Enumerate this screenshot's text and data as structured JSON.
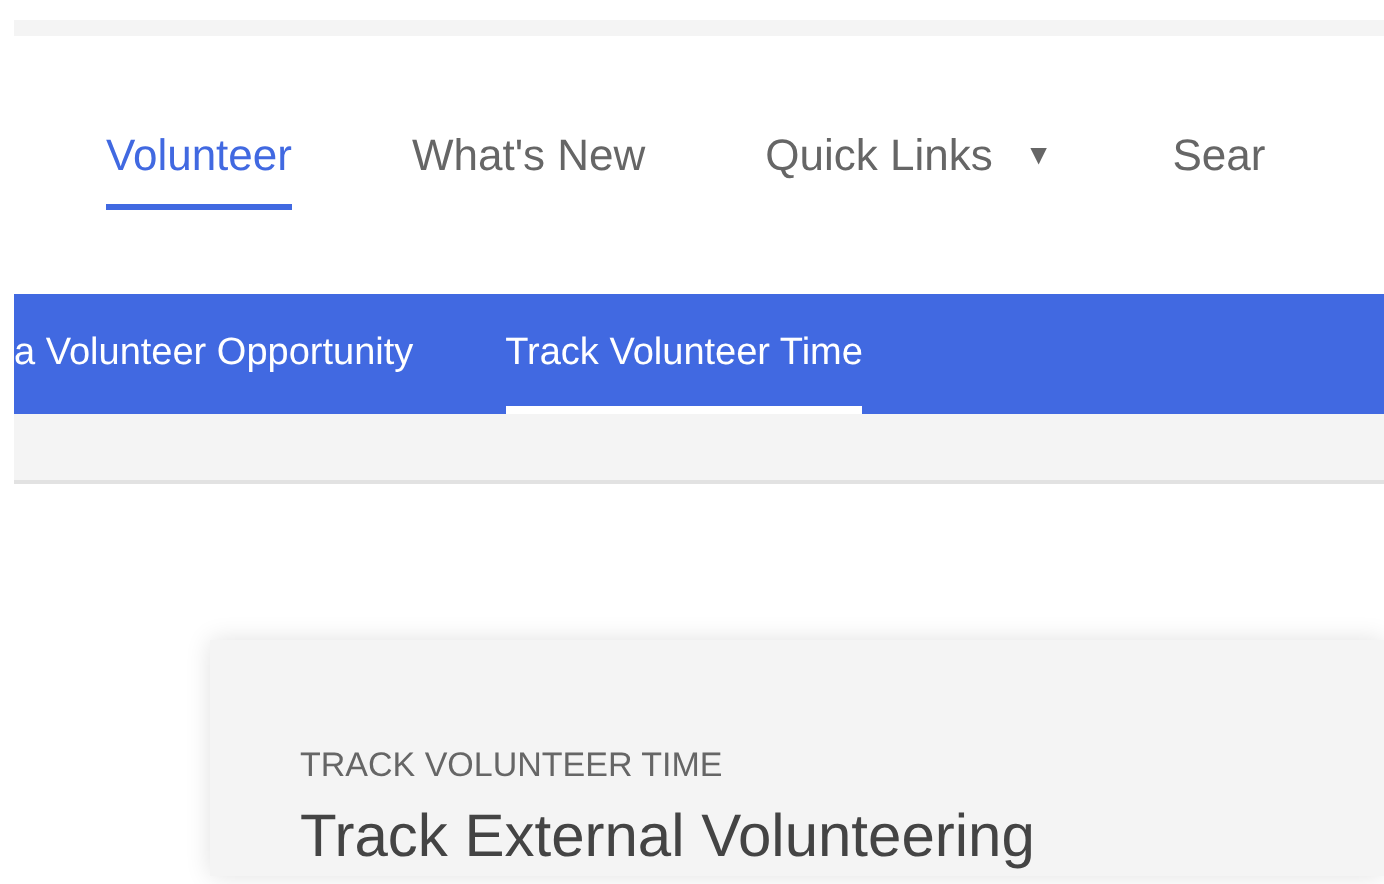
{
  "main_nav": [
    {
      "label": "Volunteer",
      "selected": true,
      "kind": "link"
    },
    {
      "label": "What's New",
      "selected": false,
      "kind": "link"
    },
    {
      "label": "Quick Links",
      "selected": false,
      "kind": "dropdown",
      "caret": "▼"
    },
    {
      "label": "Sear",
      "selected": false,
      "kind": "link"
    }
  ],
  "sub_nav": [
    {
      "label": "a Volunteer Opportunity",
      "selected": false
    },
    {
      "label": "Track Volunteer Time",
      "selected": true
    }
  ],
  "card": {
    "eyebrow": "TRACK VOLUNTEER TIME",
    "title": "Track External Volunteering"
  }
}
